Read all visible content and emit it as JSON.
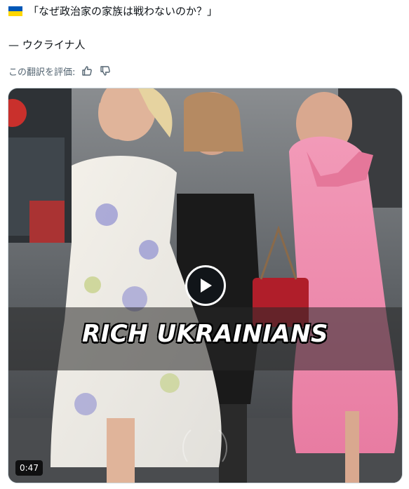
{
  "post": {
    "flag_icon": "ukraine-flag-icon",
    "flag_colors": {
      "top": "#0057b7",
      "bottom": "#ffd700"
    },
    "quote": "「なぜ政治家の家族は戦わないのか？」",
    "attribution": "— ウクライナ人"
  },
  "translate": {
    "label": "この翻訳を評価:",
    "thumbs_up_icon": "thumbs-up-icon",
    "thumbs_down_icon": "thumbs-down-icon"
  },
  "video": {
    "caption": "RICH UKRAINIANS",
    "duration": "0:47",
    "play_icon": "play-icon"
  }
}
